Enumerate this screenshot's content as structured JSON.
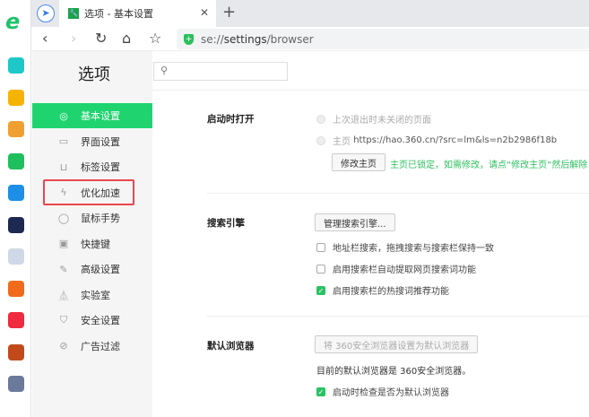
{
  "tab": {
    "title": "选项 - 基本设置"
  },
  "address": {
    "prefix": "se://",
    "bold": "settings",
    "suffix": "/browser"
  },
  "sidebar_apps": [
    {
      "name": "360-health",
      "color": "#1ec8c8"
    },
    {
      "name": "favorites",
      "color": "#f6b400"
    },
    {
      "name": "weibo",
      "color": "#f0a030"
    },
    {
      "name": "mail",
      "color": "#1fbf5e"
    },
    {
      "name": "ip",
      "color": "#1d8fe6"
    },
    {
      "name": "app-dark",
      "color": "#1d2950"
    },
    {
      "name": "docs",
      "color": "#cfd8e6"
    },
    {
      "name": "novel",
      "color": "#f06b1c"
    },
    {
      "name": "xiaohongshu",
      "color": "#f02a3f"
    },
    {
      "name": "game-1",
      "color": "#c24a1a"
    },
    {
      "name": "game-2",
      "color": "#6b7a9a"
    }
  ],
  "options": {
    "title": "选项",
    "search_placeholder": ""
  },
  "nav": [
    {
      "label": "基本设置",
      "icon": "gear-icon",
      "glyph": "◎",
      "active": true
    },
    {
      "label": "界面设置",
      "icon": "window-icon",
      "glyph": "▭"
    },
    {
      "label": "标签设置",
      "icon": "tab-icon",
      "glyph": "⊔"
    },
    {
      "label": "优化加速",
      "icon": "lightning-icon",
      "glyph": "ϟ"
    },
    {
      "label": "鼠标手势",
      "icon": "mouse-icon",
      "glyph": "◯"
    },
    {
      "label": "快捷键",
      "icon": "keyboard-icon",
      "glyph": "▣"
    },
    {
      "label": "高级设置",
      "icon": "wrench-icon",
      "glyph": "✎"
    },
    {
      "label": "实验室",
      "icon": "flask-icon",
      "glyph": "⏅"
    },
    {
      "label": "安全设置",
      "icon": "shield-icon",
      "glyph": "⛉"
    },
    {
      "label": "广告过滤",
      "icon": "block-icon",
      "glyph": "⊘"
    }
  ],
  "startup": {
    "title": "启动时打开",
    "opt1": "上次退出时未关闭的页面",
    "opt2_label": "主页",
    "opt2_url": "https://hao.360.cn/?src=lm&ls=n2b2986f18b",
    "edit_button": "修改主页",
    "lock_note": "主页已锁定，如需修改，请点“修改主页”然后解除"
  },
  "search": {
    "title": "搜索引擎",
    "manage_button": "管理搜索引擎...",
    "cb1": "地址栏搜索，拖拽搜索与搜索栏保持一致",
    "cb2": "启用搜索栏自动提取网页搜索词功能",
    "cb3": "启用搜索栏的热搜词推荐功能"
  },
  "default": {
    "title": "默认浏览器",
    "set_button": "将 360安全浏览器设置为默认浏览器",
    "status": "目前的默认浏览器是 360安全浏览器。",
    "cb": "启动时检查是否为默认浏览器"
  },
  "accent": "#1fd46f"
}
